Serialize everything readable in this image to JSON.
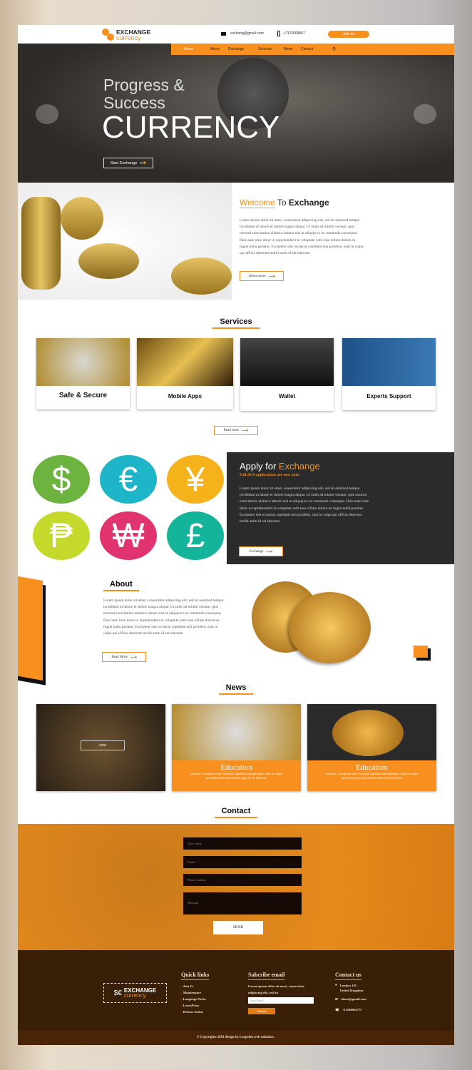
{
  "header": {
    "logo_top": "EXCHANGE",
    "logo_bottom": "currency",
    "email": "exchang@gmail.com",
    "phone": "+7123569847",
    "join": "Join us"
  },
  "nav": [
    "Home",
    "About",
    "Exchange",
    "Services",
    "News",
    "Contact"
  ],
  "hero": {
    "line1": "Progress &",
    "line2": "Success",
    "line3": "CURRENCY",
    "button": "Start Exchange"
  },
  "welcome": {
    "title_a": "Welcome",
    "title_b": " To ",
    "title_c": "Exchange",
    "text": "Lorem ipsum dolor sit amet, consectetur adipiscing elit, sed do eiusmod tempor incididunt ut labore et dolore magna aliqua. Ut enim ad minim veniam, quis nostrud exercitation ullamco laboris nisi ut aliquip ex ea commodo consequat. Duis aute irure dolor in reprehenderit in voluptate velit esse cillum dolore eu fugiat nulla pariatur. Excepteur sint occaecat cupidatat non proident, sunt in culpa qui officia deserunt mollit anim id est laborum",
    "button": "About more"
  },
  "services": {
    "title": "Services",
    "cards": [
      "Safe & Secure",
      "Mobile Apps",
      "Wallet",
      "Experts Support"
    ],
    "button": "Read more"
  },
  "currencies": [
    {
      "symbol": "$",
      "color": "#6cb33f"
    },
    {
      "symbol": "€",
      "color": "#1fb5c8"
    },
    {
      "symbol": "¥",
      "color": "#f5b21a"
    },
    {
      "symbol": "₱",
      "color": "#c5d92d"
    },
    {
      "symbol": "₩",
      "color": "#e0336f"
    },
    {
      "symbol": "£",
      "color": "#13b49a"
    }
  ],
  "apply": {
    "title_a": "Apply for ",
    "title_b": "Exchange",
    "subtitle": "Fall 2019 applications are now open",
    "text": "Lorem ipsum dolor sit amet, consectetur adipiscing elit, sed do eiusmod tempor incididunt ut labore et dolore magna aliqua. Ut enim ad minim veniam, quis nostrud exercitation ullamco laboris nisi ut aliquip ex ea commodo consequat. Duis aute irure dolor in reprehenderit in voluptate velit esse cillum dolore eu fugiat nulla pariatur. Excepteur sint occaecat cupidatat non proident, sunt in culpa qui officia deserunt mollit anim id est laborum.",
    "button": "Exchange"
  },
  "about": {
    "title": "About",
    "text": "Lorem ipsum dolor sit amet, consectetur adipiscing elit, sed do eiusmod tempor incididunt ut labore et dolore magna aliqua. Ut enim ad minim veniam, quis nostrud exercitation ullamco laboris nisi ut aliquip ex ea commodo consequat. Duis aute irure dolor in reprehenderit in voluptate velit esse cillum dolore eu fugiat nulla pariatur. Excepteur sint occaecat cupidatat non proident, sunt in culpa qui officia deserunt mollit anim id est laborum",
    "button": "Read More"
  },
  "news": {
    "title": "News",
    "view": "view",
    "cards": [
      {
        "title": "Education",
        "text": "pariatur. Excepteur sint occaecat cupidatat non proident, sunt in culpa qui officia deserunt mollit anim id est laborum"
      },
      {
        "title": "Education",
        "text": "pariatur. Excepteur sint occaecat cupidatat non proident, sunt in culpa qui officia deserunt mollit anim id est laborum"
      }
    ]
  },
  "contact": {
    "title": "Contact",
    "name": "Your name",
    "email": "Email",
    "phone": "Phone number",
    "message": "Message",
    "send": "SEND"
  },
  "footer": {
    "quick_title": "Quick links",
    "links": [
      "Join Us",
      "Maintenance",
      "Language Packs",
      "LearnPress",
      "Release Status"
    ],
    "sub_title": "Subcribe email",
    "sub_text": "Lorem ipsum dolor sit amet, consectetur adipiscing elit, sed do",
    "sub_placeholder": "Your Email",
    "submit": "Submit",
    "contact_title": "Contact us",
    "address1": "London 145",
    "address2": "United Kingdom",
    "email": "educa@gmail.com",
    "phone": "+12586954775",
    "copyright": "© Copyrights 2019 design by Leopedia  web solutions ."
  },
  "colors": {
    "accent": "#f7901e",
    "dark": "#2b2b2b",
    "footer": "#3a1f08"
  }
}
